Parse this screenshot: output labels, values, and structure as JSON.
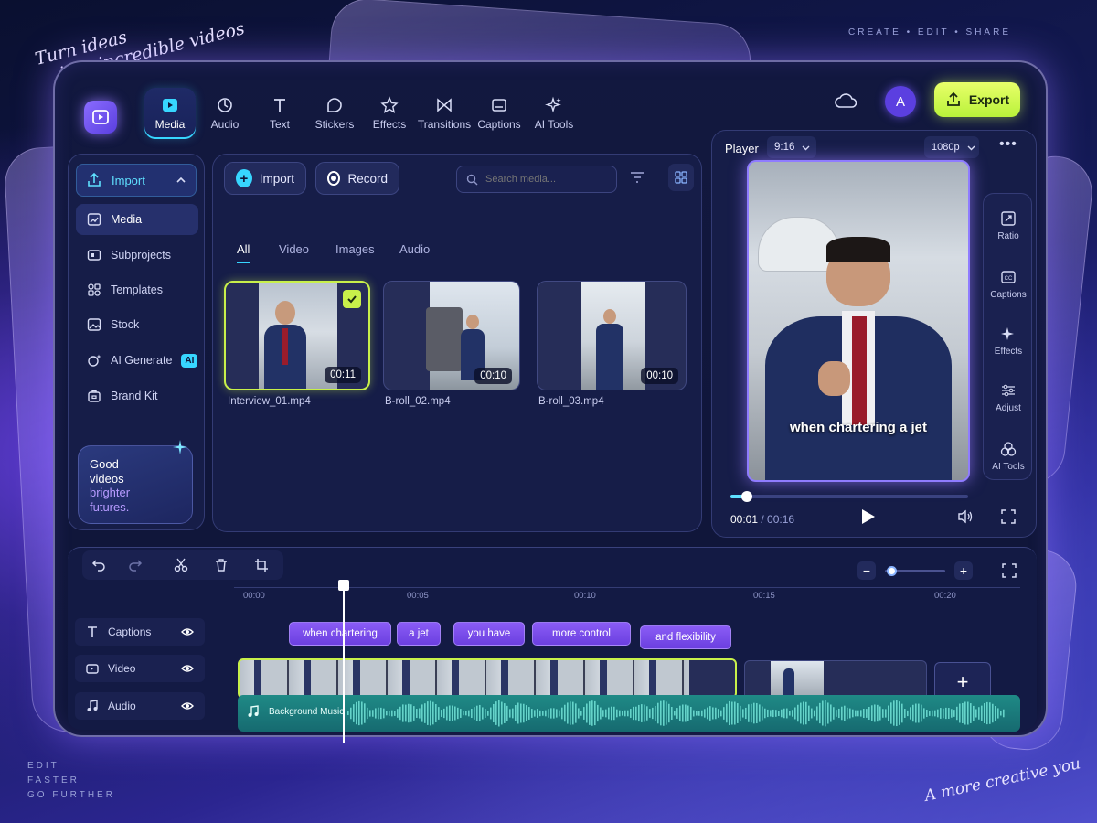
{
  "promo": {
    "tagline_line1": "Turn ideas",
    "tagline_line2": "into incredible videos",
    "top_right": "CREATE  •  EDIT  •  SHARE",
    "bottom_left_1": "EDIT",
    "bottom_left_2": "FASTER",
    "bottom_left_3": "GO FURTHER",
    "bottom_right": "A more creative you"
  },
  "toolbar": {
    "tabs": [
      {
        "label": "Media",
        "icon": "media-icon"
      },
      {
        "label": "Audio",
        "icon": "audio-icon"
      },
      {
        "label": "Text",
        "icon": "text-icon"
      },
      {
        "label": "Stickers",
        "icon": "stickers-icon"
      },
      {
        "label": "Effects",
        "icon": "effects-icon"
      },
      {
        "label": "Transitions",
        "icon": "transitions-icon"
      },
      {
        "label": "Captions",
        "icon": "captions-icon"
      },
      {
        "label": "AI Tools",
        "icon": "ai-tools-icon"
      }
    ],
    "active_tab": "Media",
    "avatar_letter": "A",
    "export_label": "Export"
  },
  "sidebar": {
    "import_label": "Import",
    "items": [
      {
        "label": "Media"
      },
      {
        "label": "Subprojects"
      },
      {
        "label": "Templates"
      },
      {
        "label": "Stock"
      },
      {
        "label": "AI Generate",
        "badge": "AI"
      },
      {
        "label": "Brand Kit"
      }
    ],
    "promo_line1": "Good",
    "promo_line2": "videos",
    "promo_line3": "brighter",
    "promo_line4": "futures."
  },
  "media": {
    "import_label": "Import",
    "record_label": "Record",
    "search_placeholder": "Search media...",
    "tabs": [
      "All",
      "Video",
      "Images",
      "Audio"
    ],
    "active_tab": "All",
    "files": [
      {
        "name": "Interview_01.mp4",
        "duration": "00:11",
        "selected": true
      },
      {
        "name": "B-roll_02.mp4",
        "duration": "00:10",
        "selected": false
      },
      {
        "name": "B-roll_03.mp4",
        "duration": "00:10",
        "selected": false
      }
    ]
  },
  "player": {
    "title": "Player",
    "aspect": "9:16",
    "resolution": "1080p",
    "caption": "when chartering a jet",
    "current_time": "00:01",
    "total_time": "00:16",
    "progress": 0.07,
    "tools": [
      {
        "label": "Ratio"
      },
      {
        "label": "Captions"
      },
      {
        "label": "Effects"
      },
      {
        "label": "Adjust"
      },
      {
        "label": "AI Tools"
      }
    ]
  },
  "timeline": {
    "ruler": [
      "00:00",
      "00:05",
      "00:10",
      "00:15",
      "00:20"
    ],
    "tracks": [
      {
        "label": "Captions"
      },
      {
        "label": "Video"
      },
      {
        "label": "Audio"
      }
    ],
    "captions": [
      "when chartering",
      "a jet",
      "you have",
      "more control",
      "and flexibility"
    ],
    "audio_label": "Background Music",
    "add_label": "+",
    "zoom_level": 0.1
  },
  "colors": {
    "accent": "#c8f04a",
    "primary": "#6b3fe0",
    "cyan": "#37d6ff",
    "audio": "#1f8a86"
  }
}
